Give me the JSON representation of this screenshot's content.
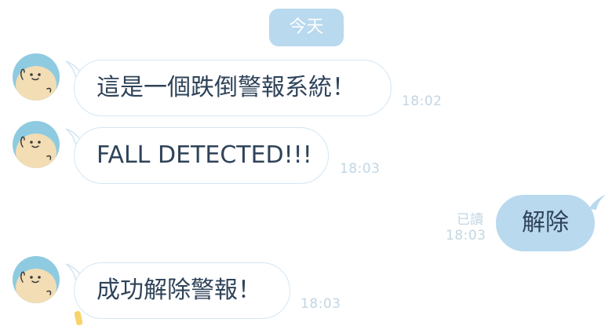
{
  "chat": {
    "date_label": "今天",
    "messages": [
      {
        "sender": "bot",
        "text": "這是一個跌倒警報系統！",
        "time": "18:02"
      },
      {
        "sender": "bot",
        "text": "FALL DETECTED!!!",
        "time": "18:03"
      },
      {
        "sender": "me",
        "text": "解除",
        "time": "18:03",
        "read_status": "已讀"
      },
      {
        "sender": "bot",
        "text": "成功解除警報！",
        "time": "18:03"
      }
    ]
  },
  "colors": {
    "accent": "#b9d9ee",
    "incoming_border": "#d4e6f3",
    "text": "#2f4359",
    "timestamp": "#c2d6e4",
    "avatar_bg": "#8ecbe0",
    "avatar_face": "#f2ddb5"
  },
  "icons": {
    "avatar": "bot-avatar-icon"
  }
}
